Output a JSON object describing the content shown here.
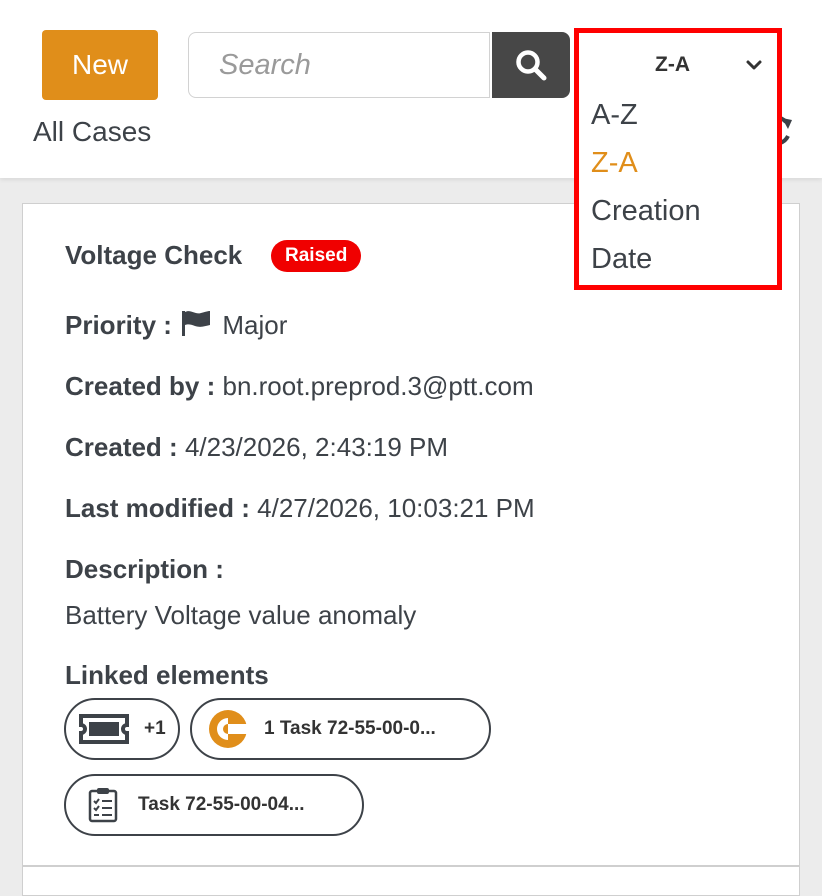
{
  "header": {
    "new_label": "New",
    "search_placeholder": "Search",
    "title": "All Cases"
  },
  "sort": {
    "selected": "Z-A",
    "options": [
      "A-Z",
      "Z-A",
      "Creation",
      "Date"
    ],
    "active_option": "Z-A"
  },
  "case": {
    "title": "Voltage Check",
    "status": "Raised",
    "priority_label": "Priority :",
    "priority_value": "Major",
    "created_by_label": "Created by :",
    "created_by_value": "bn.root.preprod.3@ptt.com",
    "created_label": "Created :",
    "created_value": "4/23/2026, 2:43:19 PM",
    "modified_label": "Last modified :",
    "modified_value": "4/27/2026, 10:03:21 PM",
    "description_label": "Description :",
    "description_value": "Battery Voltage value anomaly",
    "linked_label": "Linked elements",
    "linked": [
      {
        "icon": "ticket-icon",
        "label": "+1"
      },
      {
        "icon": "task-progress-icon",
        "label": "1 Task 72-55-00-0..."
      },
      {
        "icon": "checklist-icon",
        "label": "Task 72-55-00-04..."
      }
    ]
  },
  "colors": {
    "accent": "#e08e1a",
    "status_raised": "#f00000",
    "dark": "#474747",
    "highlight_border": "#ff0000"
  }
}
